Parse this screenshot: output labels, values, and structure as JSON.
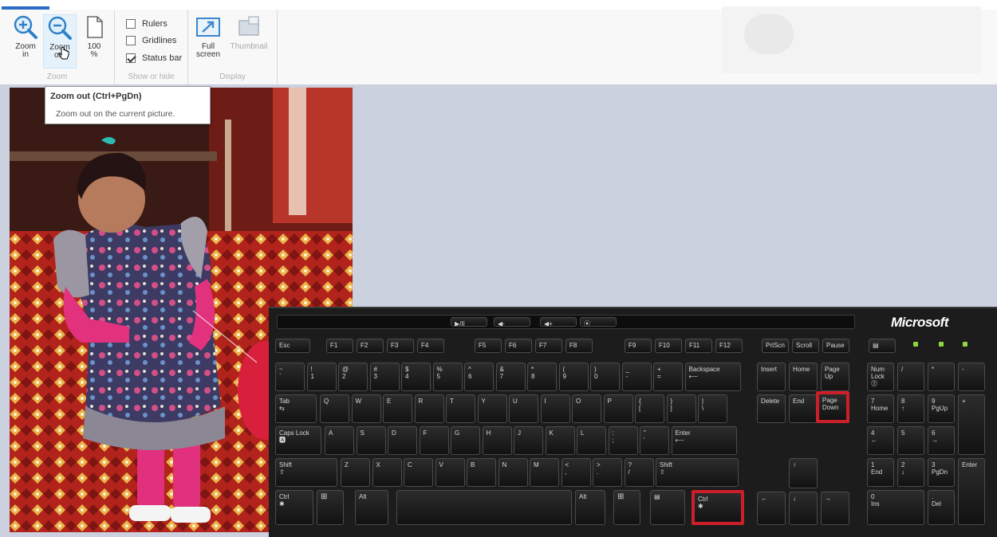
{
  "ribbon": {
    "groups": {
      "zoom": {
        "label": "Zoom",
        "buttons": [
          {
            "label": "Zoom\nin",
            "icon": "zoom-in-icon"
          },
          {
            "label": "Zoom\nout",
            "icon": "zoom-out-icon"
          },
          {
            "label": "100\n%",
            "icon": "actual-size-icon"
          }
        ]
      },
      "show_or_hide": {
        "label": "Show or hide",
        "checkboxes": [
          {
            "label": "Rulers",
            "checked": false
          },
          {
            "label": "Gridlines",
            "checked": false
          },
          {
            "label": "Status bar",
            "checked": true
          }
        ]
      },
      "display": {
        "label": "Display",
        "buttons": [
          {
            "label": "Full\nscreen",
            "icon": "full-screen-icon"
          },
          {
            "label": "Thumbnail",
            "icon": "thumbnail-icon"
          }
        ]
      }
    }
  },
  "tooltip": {
    "title": "Zoom out (Ctrl+PgDn)",
    "description": "Zoom out on the current picture."
  },
  "keyboard": {
    "brand": "Microsoft",
    "highlighted_keys": [
      "Page Down",
      "Ctrl"
    ],
    "media_keys": [
      "▶/II",
      "◀-",
      "◀+",
      "⦿"
    ],
    "esc": "Esc",
    "function_keys": [
      "F1",
      "F2",
      "F3",
      "F4",
      "F5",
      "F6",
      "F7",
      "F8",
      "F9",
      "F10",
      "F11",
      "F12"
    ],
    "nav_top": [
      "PrtScn",
      "Scroll",
      "Pause"
    ],
    "number_row": [
      "~\n`",
      "!\n1",
      "@\n2",
      "#\n3",
      "$\n4",
      "%\n5",
      "^\n6",
      "&\n7",
      "*\n8",
      "(\n9",
      ")\n0",
      "_\n-",
      "+\n="
    ],
    "backspace": "Backspace\n⟵",
    "tab": "Tab\n⇆",
    "row_q": [
      "Q",
      "W",
      "E",
      "R",
      "T",
      "Y",
      "U",
      "I",
      "O",
      "P",
      "{\n[",
      "}\n]",
      "|\n\\"
    ],
    "caps_lock": "Caps Lock\n🅰",
    "row_a": [
      "A",
      "S",
      "D",
      "F",
      "G",
      "H",
      "J",
      "K",
      "L",
      ":\n;",
      "\"\n'"
    ],
    "enter": "Enter\n⟵",
    "shift": "Shift\n⇧",
    "row_z": [
      "Z",
      "X",
      "C",
      "V",
      "B",
      "N",
      "M",
      "<\n,",
      ">\n.",
      "?\n/"
    ],
    "ctrl": "Ctrl\n✱",
    "win": "⊞",
    "alt": "Alt",
    "menu": "▤",
    "nav_cluster": [
      "Insert",
      "Home",
      "Page\nUp",
      "Delete",
      "End",
      "Page\nDown"
    ],
    "arrows": [
      "↑",
      "←",
      "↓",
      "→"
    ],
    "numpad": [
      "Num\nLock\n⓵",
      "/",
      "*",
      "-",
      "7\nHome",
      "8\n↑",
      "9\nPgUp",
      "+",
      "4\n←",
      "5",
      "6\n→",
      "1\nEnd",
      "2\n↓",
      "3\nPgDn",
      "Enter",
      "0\nIns",
      ".\nDel"
    ]
  }
}
